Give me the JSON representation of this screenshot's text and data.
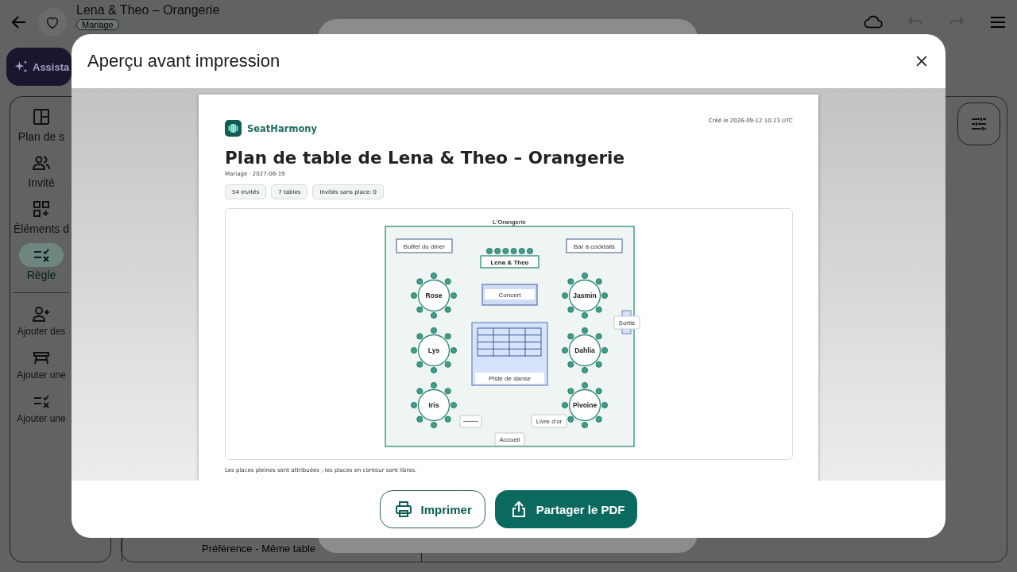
{
  "app": {
    "title": "Lena & Theo – Orangerie",
    "tag": "Mariage",
    "favorite": false,
    "undo_enabled": false,
    "redo_enabled": false,
    "assistant_label": "Assista",
    "nav": [
      {
        "label": "Plan de s",
        "selected": false
      },
      {
        "label": "Invité",
        "selected": false
      },
      {
        "label": "Éléments d",
        "selected": false
      },
      {
        "label": "Règle",
        "selected": true
      }
    ],
    "actions": [
      {
        "label": "Ajouter des"
      },
      {
        "label": "Ajouter une"
      },
      {
        "label": "Ajouter une"
      }
    ],
    "rule_card": {
      "title": "Préférence - Même table"
    }
  },
  "dialog": {
    "title": "Aperçu avant impression",
    "preview": {
      "brand": "SeatHarmony",
      "created": "Créé le 2026-09-12 10:23 UTC",
      "title": "Plan de table de Lena & Theo – Orangerie",
      "subtitle": "Mariage · 2027-06-19",
      "stats": [
        "54 invités",
        "7 tables",
        "Invités sans place: 0"
      ],
      "plan": {
        "room": "L'Orangerie",
        "zones": [
          {
            "kind": "buffet",
            "label": "Buffet du dîner"
          },
          {
            "kind": "bar",
            "label": "Bar à cocktails"
          },
          {
            "kind": "stage",
            "label": "Concert"
          },
          {
            "kind": "dance_floor",
            "label": "Piste de danse"
          },
          {
            "kind": "exit",
            "label": "Sortie"
          },
          {
            "kind": "sign"
          },
          {
            "kind": "guestbook",
            "label": "Livre d'or"
          },
          {
            "kind": "entrance",
            "label": "Accueil"
          }
        ],
        "head_table": {
          "name": "Lena & Theo",
          "seats": [
            {
              "assigned": true
            },
            {
              "assigned": true
            },
            {
              "assigned": true
            },
            {
              "assigned": true
            },
            {
              "assigned": true
            },
            {
              "assigned": true
            }
          ]
        },
        "tables": [
          {
            "name": "Rose",
            "seats": [
              {
                "assigned": true
              },
              {
                "assigned": true
              },
              {
                "assigned": true
              },
              {
                "assigned": true
              },
              {
                "assigned": true
              },
              {
                "assigned": true
              },
              {
                "assigned": true
              },
              {
                "assigned": true
              }
            ]
          },
          {
            "name": "Jasmin",
            "seats": [
              {
                "assigned": true
              },
              {
                "assigned": true
              },
              {
                "assigned": true
              },
              {
                "assigned": true
              },
              {
                "assigned": true
              },
              {
                "assigned": true
              },
              {
                "assigned": true
              },
              {
                "assigned": true
              }
            ]
          },
          {
            "name": "Lys",
            "seats": [
              {
                "assigned": true
              },
              {
                "assigned": true
              },
              {
                "assigned": true
              },
              {
                "assigned": true
              },
              {
                "assigned": true
              },
              {
                "assigned": true
              },
              {
                "assigned": true
              },
              {
                "assigned": true
              }
            ]
          },
          {
            "name": "Dahlia",
            "seats": [
              {
                "assigned": true
              },
              {
                "assigned": true
              },
              {
                "assigned": true
              },
              {
                "assigned": true
              },
              {
                "assigned": true
              },
              {
                "assigned": true
              },
              {
                "assigned": true
              },
              {
                "assigned": true
              }
            ]
          },
          {
            "name": "Iris",
            "seats": [
              {
                "assigned": true
              },
              {
                "assigned": true
              },
              {
                "assigned": true
              },
              {
                "assigned": true
              },
              {
                "assigned": true
              },
              {
                "assigned": true
              },
              {
                "assigned": true
              },
              {
                "assigned": true
              }
            ]
          },
          {
            "name": "Pivoine",
            "seats": [
              {
                "assigned": true
              },
              {
                "assigned": true
              },
              {
                "assigned": true
              },
              {
                "assigned": true
              },
              {
                "assigned": true
              },
              {
                "assigned": true
              },
              {
                "assigned": true
              },
              {
                "assigned": true
              }
            ]
          }
        ]
      },
      "footnote": "Les places pleines sont attribuées ; les places en contour sont libres."
    },
    "buttons": [
      {
        "kind": "print",
        "label": "Imprimer"
      },
      {
        "kind": "share",
        "label": "Partager le PDF"
      }
    ]
  }
}
